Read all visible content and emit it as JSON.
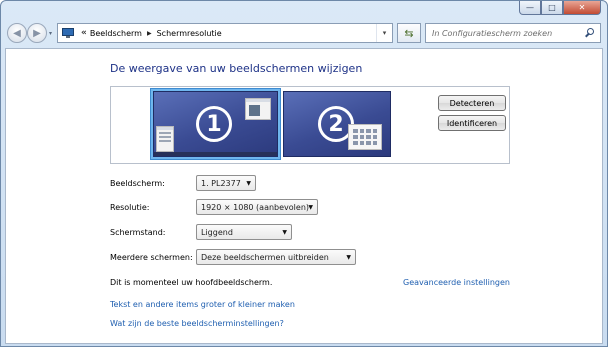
{
  "window": {
    "controls": {
      "minimize": "—",
      "maximize": "□",
      "close": "✕"
    }
  },
  "nav": {
    "back_icon": "back-arrow-icon",
    "forward_icon": "forward-arrow-icon",
    "history_glyph": "▾",
    "breadcrumb_chevron": "«",
    "breadcrumb": [
      "Beeldscherm",
      "Schermresolutie"
    ],
    "breadcrumb_sep": "▶",
    "dropdown_glyph": "▾",
    "refresh_glyph": "⇆",
    "search_placeholder": "In Configuratiescherm zoeken"
  },
  "main": {
    "heading": "De weergave van uw beeldschermen wijzigen",
    "monitors": [
      {
        "number": "1",
        "selected": true
      },
      {
        "number": "2",
        "selected": false
      }
    ],
    "buttons": {
      "detect": "Detecteren",
      "identify": "Identificeren"
    },
    "settings": [
      {
        "label": "Beeldscherm:",
        "value": "1. PL2377"
      },
      {
        "label": "Resolutie:",
        "value": "1920 × 1080 (aanbevolen)"
      },
      {
        "label": "Schermstand:",
        "value": "Liggend"
      },
      {
        "label": "Meerdere schermen:",
        "value": "Deze beeldschermen uitbreiden"
      }
    ],
    "dropdown_arrow": "▼",
    "main_display_note": "Dit is momenteel uw hoofdbeeldscherm.",
    "advanced_link": "Geavanceerde instellingen",
    "links": [
      "Tekst en andere items groter of kleiner maken",
      "Wat zijn de beste beeldscherminstellingen?"
    ]
  },
  "colors": {
    "heading": "#1e3287",
    "link": "#1f5fb0",
    "monitor": "#3a4b93",
    "selection": "#6fb6ee"
  }
}
